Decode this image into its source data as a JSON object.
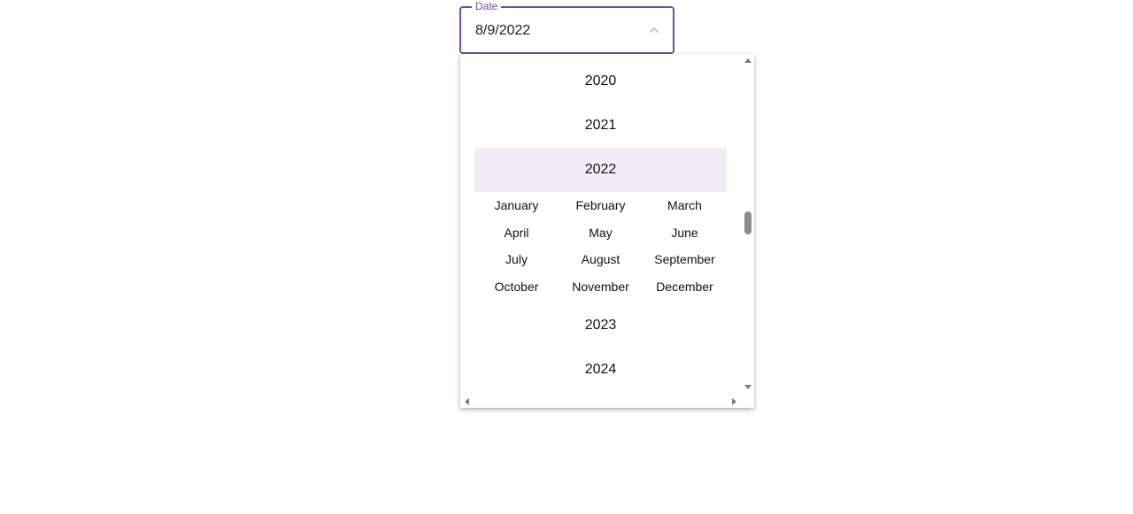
{
  "field": {
    "label": "Date",
    "value": "8/9/2022",
    "toggle_icon": "chevron-up-icon"
  },
  "picker": {
    "years_before": [
      "2020",
      "2021"
    ],
    "selected_year": "2022",
    "months": [
      "January",
      "February",
      "March",
      "April",
      "May",
      "June",
      "July",
      "August",
      "September",
      "October",
      "November",
      "December"
    ],
    "years_after": [
      "2023",
      "2024"
    ]
  },
  "colors": {
    "accent": "#6a4fa3",
    "selected_background": "#f1ecf7",
    "scrollbar_thumb": "#8c8c8c"
  }
}
